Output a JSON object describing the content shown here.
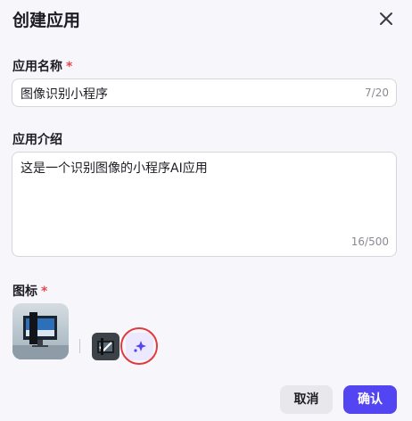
{
  "dialog": {
    "title": "创建应用"
  },
  "name_field": {
    "label": "应用名称",
    "required_mark": "*",
    "value": "图像识别小程序",
    "counter": "7/20"
  },
  "intro_field": {
    "label": "应用介绍",
    "value": "这是一个识别图像的小程序AI应用",
    "counter": "16/500"
  },
  "icon_field": {
    "label": "图标",
    "required_mark": "*"
  },
  "footer": {
    "cancel_label": "取消",
    "confirm_label": "确认"
  },
  "colors": {
    "primary": "#5346f2",
    "required": "#e5484d",
    "highlight_ring": "#e03b3b"
  },
  "icons": [
    "close-icon",
    "app-icon-preview",
    "image-picker-icon",
    "sparkle-icon"
  ]
}
